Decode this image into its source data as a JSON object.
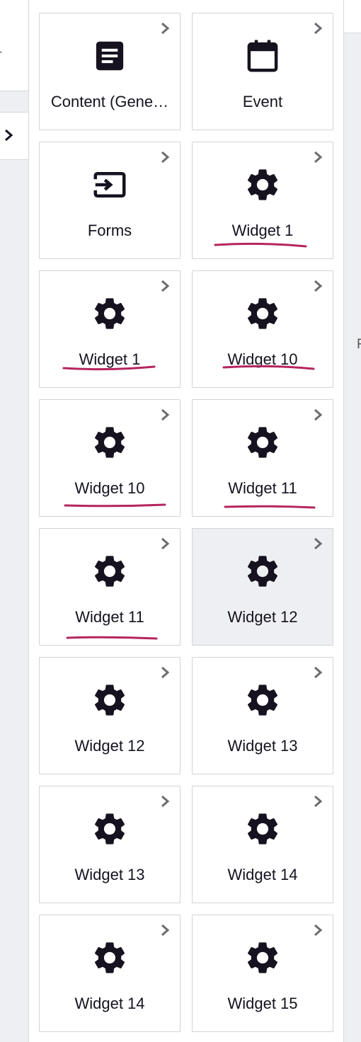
{
  "colors": {
    "icon": "#16121f",
    "chevron": "#6b6b70",
    "annotation": "#b5255f",
    "selected_bg": "#eeeff2"
  },
  "right_strip": {
    "letter": "F"
  },
  "tiles": [
    {
      "label": "Content (Gene…",
      "icon": "document-icon"
    },
    {
      "label": "Event",
      "icon": "calendar-icon"
    },
    {
      "label": "Forms",
      "icon": "input-form-icon"
    },
    {
      "label": "Widget 1",
      "icon": "gear-icon"
    },
    {
      "label": "Widget 1",
      "icon": "gear-icon"
    },
    {
      "label": "Widget 10",
      "icon": "gear-icon"
    },
    {
      "label": "Widget 10",
      "icon": "gear-icon"
    },
    {
      "label": "Widget 11",
      "icon": "gear-icon"
    },
    {
      "label": "Widget 11",
      "icon": "gear-icon"
    },
    {
      "label": "Widget 12",
      "icon": "gear-icon",
      "selected": true
    },
    {
      "label": "Widget 12",
      "icon": "gear-icon"
    },
    {
      "label": "Widget 13",
      "icon": "gear-icon"
    },
    {
      "label": "Widget 13",
      "icon": "gear-icon"
    },
    {
      "label": "Widget 14",
      "icon": "gear-icon"
    },
    {
      "label": "Widget 14",
      "icon": "gear-icon"
    },
    {
      "label": "Widget 15",
      "icon": "gear-icon"
    }
  ]
}
